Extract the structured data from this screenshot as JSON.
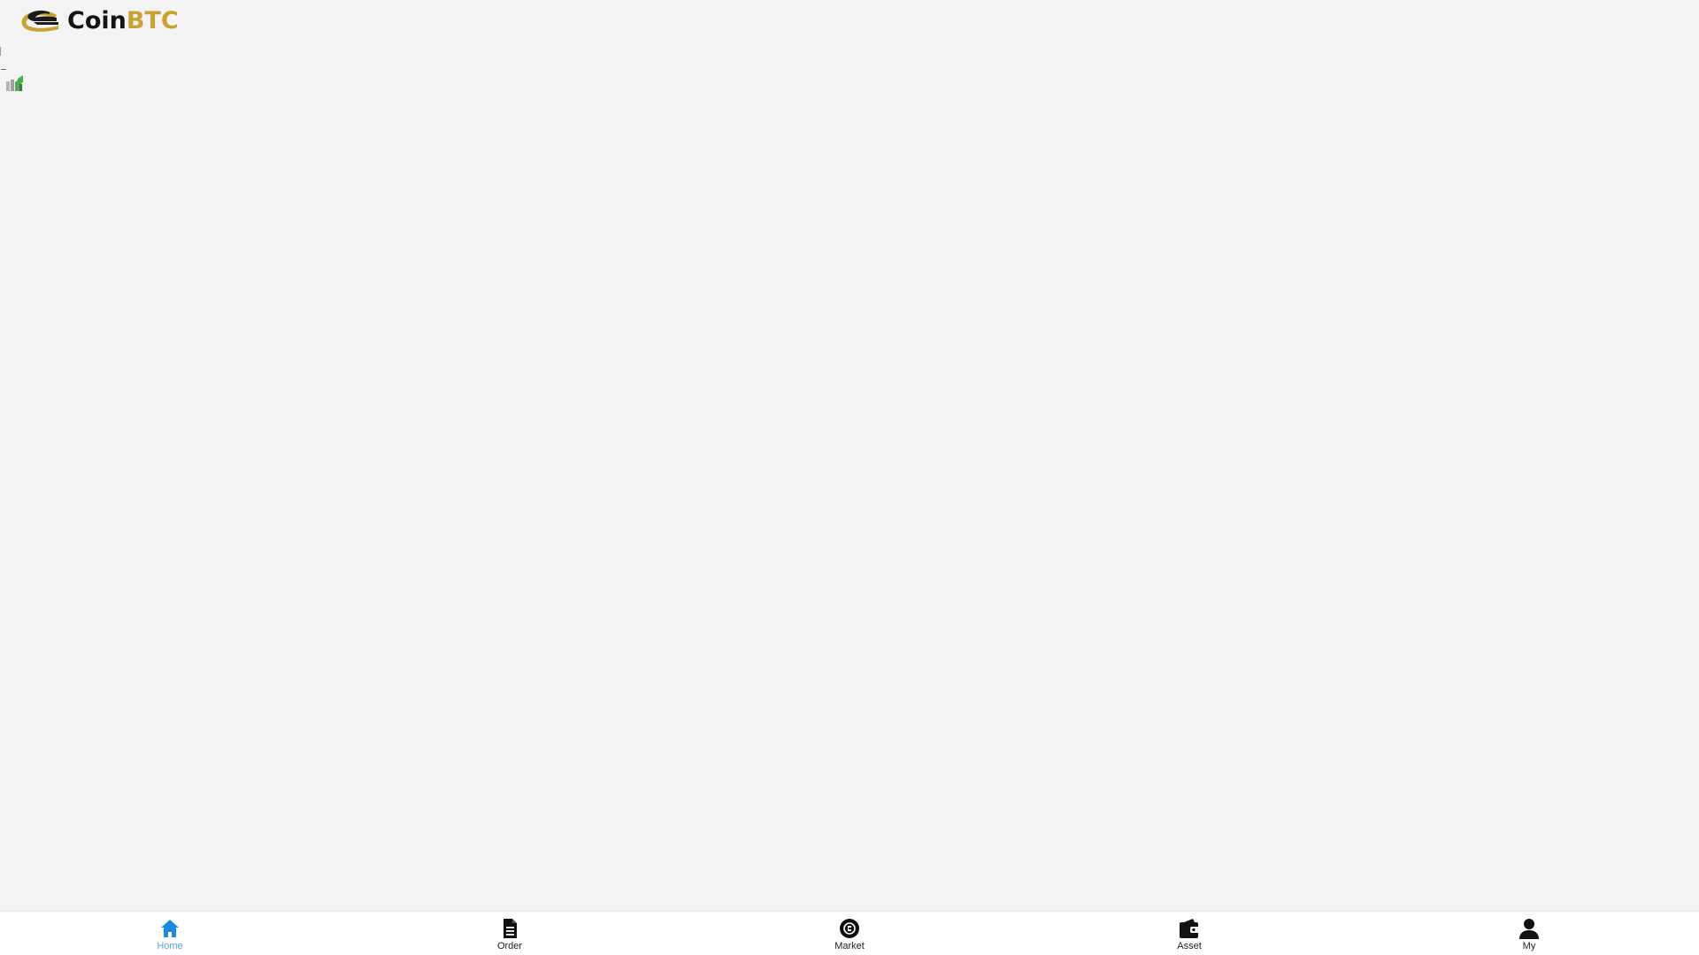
{
  "brand": {
    "name_part1": "Coin",
    "name_part2": "BTC",
    "colors": {
      "coin_text": "#141414",
      "btc_text": "#c9a230",
      "mark_dark": "#1a1a1a",
      "mark_gold": "#c9a230"
    }
  },
  "content": {
    "broken_image_icon": "broken-image-icon"
  },
  "tabbar": {
    "active_color": "#4fa3e0",
    "text_color": "#222222",
    "tabs": [
      {
        "label": "Home",
        "icon": "home-icon",
        "active": true
      },
      {
        "label": "Order",
        "icon": "document-icon",
        "active": false
      },
      {
        "label": "Market",
        "icon": "market-icon",
        "active": false
      },
      {
        "label": "Asset",
        "icon": "wallet-icon",
        "active": false
      },
      {
        "label": "My",
        "icon": "user-icon",
        "active": false
      }
    ]
  }
}
